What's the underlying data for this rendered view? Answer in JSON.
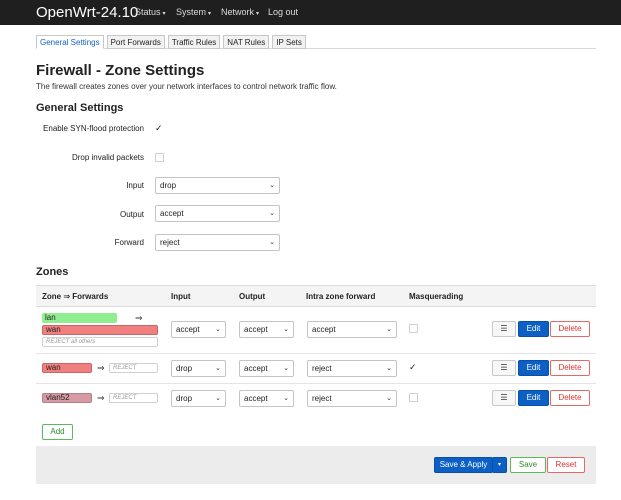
{
  "nav": {
    "brand": "OpenWrt-24.10",
    "menu": [
      {
        "label": "Status",
        "caret": "▾"
      },
      {
        "label": "System",
        "caret": "▾"
      },
      {
        "label": "Network",
        "caret": "▾"
      },
      {
        "label": "Log out",
        "caret": ""
      }
    ]
  },
  "tabs": [
    "General Settings",
    "Port Forwards",
    "Traffic Rules",
    "NAT Rules",
    "IP Sets"
  ],
  "page": {
    "title": "Firewall - Zone Settings",
    "description": "The firewall creates zones over your network interfaces to control network traffic flow."
  },
  "general": {
    "heading": "General Settings",
    "syn_flood_label": "Enable SYN-flood protection",
    "syn_flood_checked": true,
    "drop_invalid_label": "Drop invalid packets",
    "drop_invalid_checked": false,
    "input_label": "Input",
    "input_value": "drop",
    "output_label": "Output",
    "output_value": "accept",
    "forward_label": "Forward",
    "forward_value": "reject"
  },
  "zones": {
    "heading": "Zones",
    "columns": {
      "zone": "Zone ⇒ Forwards",
      "input": "Input",
      "output": "Output",
      "intra": "Intra zone forward",
      "masq": "Masquerading"
    },
    "rows": [
      {
        "zone": "lan",
        "forward_targets": [
          "wan"
        ],
        "forward_note": "REJECT all others",
        "input": "accept",
        "output": "accept",
        "intra": "accept",
        "masquerading": false
      },
      {
        "zone": "wan",
        "forward_placeholder": "REJECT",
        "input": "drop",
        "output": "accept",
        "intra": "reject",
        "masquerading": true
      },
      {
        "zone": "vlan52",
        "forward_placeholder": "REJECT",
        "input": "drop",
        "output": "accept",
        "intra": "reject",
        "masquerading": false
      }
    ],
    "row_buttons": {
      "menu": "☰",
      "edit": "Edit",
      "delete": "Delete"
    },
    "add_label": "Add"
  },
  "footer": {
    "save_apply": "Save & Apply",
    "save": "Save",
    "reset": "Reset"
  },
  "symbols": {
    "arrow": "⇒",
    "checkmark": "✓",
    "dropdown": "⌄",
    "split_caret": "▾"
  },
  "colors": {
    "accent": "#0c5fc4",
    "lan": "#90ee90",
    "wan": "#f08080",
    "vlan52": "#d79aa3",
    "danger": "#d33333",
    "success": "#2e8b2e"
  }
}
